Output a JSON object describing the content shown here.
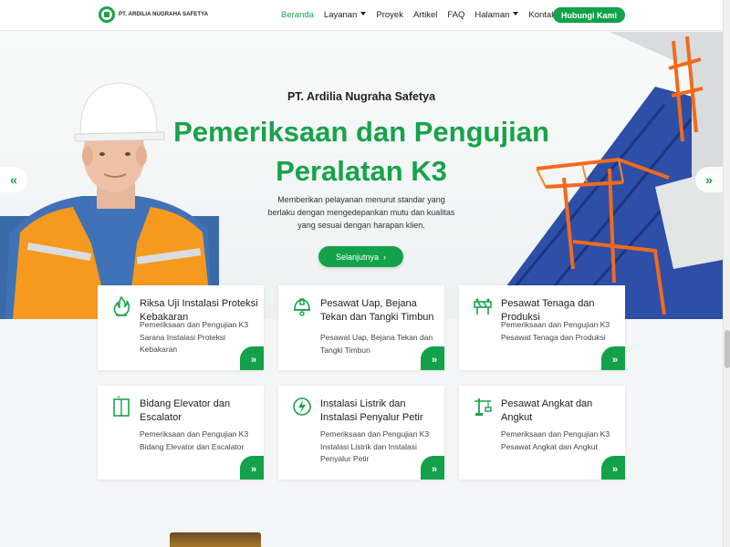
{
  "brand": {
    "name": "PT. ARDILIA NUGRAHA SAFETYA",
    "accent": "#13a24a"
  },
  "nav": {
    "items": [
      {
        "label": "Beranda",
        "active": true,
        "dropdown": false
      },
      {
        "label": "Layanan",
        "active": false,
        "dropdown": true
      },
      {
        "label": "Proyek",
        "active": false,
        "dropdown": false
      },
      {
        "label": "Artikel",
        "active": false,
        "dropdown": false
      },
      {
        "label": "FAQ",
        "active": false,
        "dropdown": false
      },
      {
        "label": "Halaman",
        "active": false,
        "dropdown": true
      },
      {
        "label": "Kontak",
        "active": false,
        "dropdown": false
      }
    ],
    "cta": "Hubungi Kami"
  },
  "hero": {
    "subtitle": "PT. Ardilia Nugraha Safetya",
    "title_line1": "Pemeriksaan dan Pengujian",
    "title_line2": "Peralatan K3",
    "desc_line1": "Memberikan pelayanan menurut standar yang",
    "desc_line2": "berlaku dengan mengedepankan mutu dan kualitas",
    "desc_line3": "yang sesuai dengan harapan klien.",
    "button": "Selanjutnya",
    "button_icon": "chevron-right-icon",
    "prev_icon": "double-chevron-left-icon",
    "next_icon": "double-chevron-right-icon"
  },
  "services": [
    {
      "title": "Riksa Uji Instalasi Proteksi Kebakaran",
      "desc": "Pemeriksaan dan Pengujian K3 Sarana Instalasi Proteksi Kebakaran",
      "icon": "fire-icon"
    },
    {
      "title": "Pesawat Uap, Bejana Tekan dan Tangki Timbun",
      "desc": "Pesawat Uap, Bejana Tekan dan Tangki Timbun",
      "icon": "helmet-icon"
    },
    {
      "title": "Pesawat Tenaga dan Produksi",
      "desc": "Pemeriksaan dan Pengujian K3 Pesawat Tenaga dan Produksi",
      "icon": "barrier-icon"
    },
    {
      "title": "Bidang Elevator dan Escalator",
      "desc": "Pemeriksaan dan Pengujian K3 Bidang Elevator dan Escalator",
      "icon": "elevator-icon"
    },
    {
      "title": "Instalasi Listrik dan Instalasi Penyalur Petir",
      "desc": "Pemeriksaan dan Pengujian K3 Instalasi Listrik dan Instalasi Penyalur Petir",
      "icon": "lightning-icon"
    },
    {
      "title": "Pesawat Angkat dan Angkut",
      "desc": "Pemeriksaan dan Pengujian K3 Pesawat Angkat dan Angkut",
      "icon": "crane-icon"
    }
  ]
}
